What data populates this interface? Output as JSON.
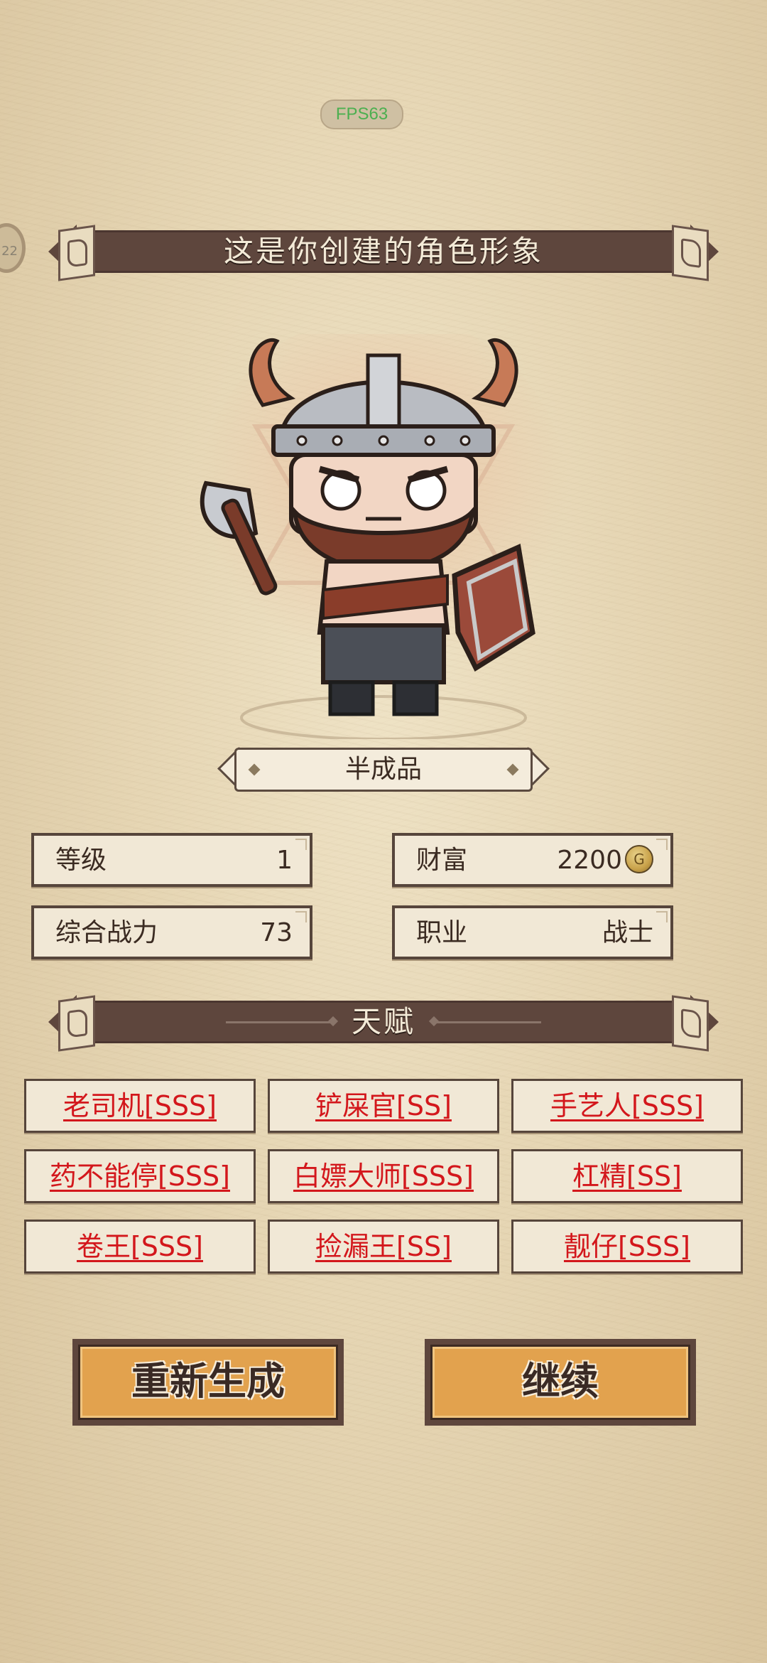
{
  "hud": {
    "fps": "FPS63",
    "side_badge": "22"
  },
  "header": {
    "title": "这是你创建的角色形象"
  },
  "character": {
    "name": "半成品"
  },
  "stats": {
    "level_label": "等级",
    "level_value": "1",
    "wealth_label": "财富",
    "wealth_value": "2200",
    "coin_icon": "G",
    "power_label": "综合战力",
    "power_value": "73",
    "class_label": "职业",
    "class_value": "战士"
  },
  "talents": {
    "title": "天赋",
    "items": [
      "老司机[SSS]",
      "铲屎官[SS]",
      "手艺人[SSS]",
      "药不能停[SSS]",
      "白嫖大师[SSS]",
      "杠精[SS]",
      "卷王[SSS]",
      "捡漏王[SS]",
      "靓仔[SSS]"
    ]
  },
  "buttons": {
    "regenerate": "重新生成",
    "continue": "继续"
  }
}
